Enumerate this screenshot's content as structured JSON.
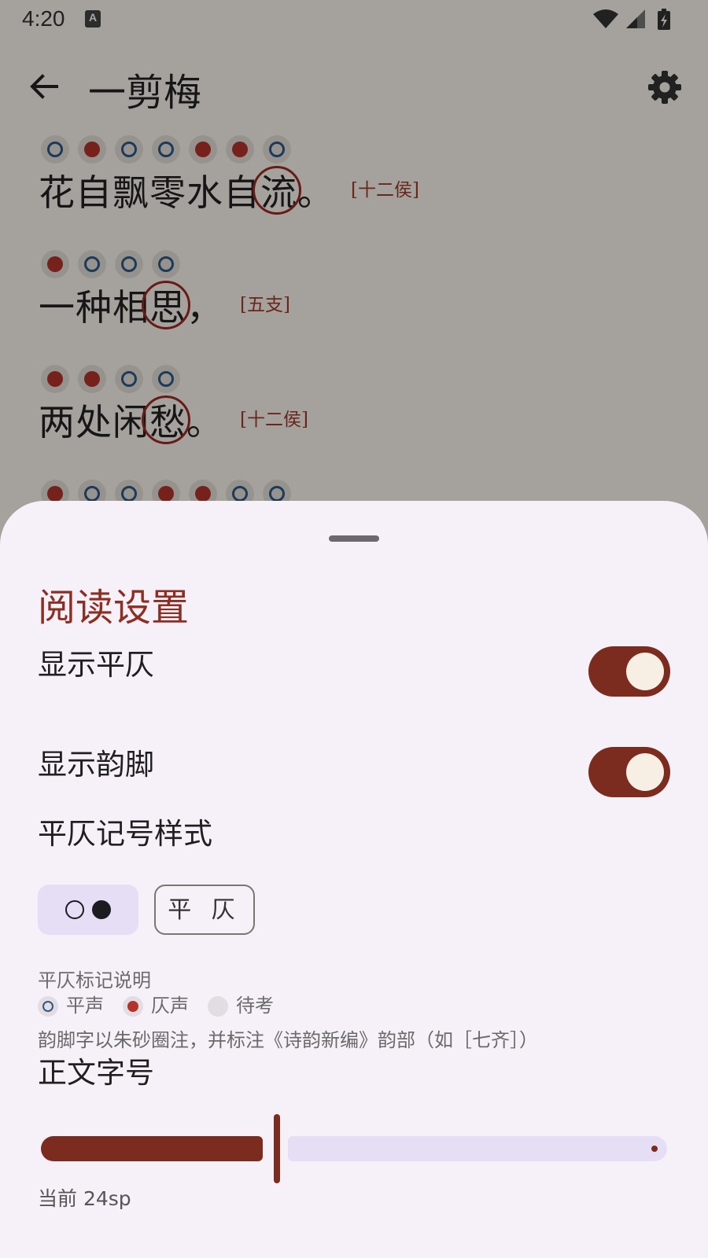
{
  "status_bar": {
    "time": "4:20",
    "notification_icon": "A"
  },
  "app_bar": {
    "title": "一剪梅"
  },
  "poem": {
    "lines": [
      {
        "chars": [
          "花",
          "自",
          "飘",
          "零",
          "水",
          "自",
          "流",
          "。"
        ],
        "marks": [
          "ping",
          "ze",
          "ping",
          "ping",
          "ze",
          "ze",
          "ping"
        ],
        "rhyme_index": 6,
        "rhyme_tag": "[十二侯]"
      },
      {
        "chars": [
          "一",
          "种",
          "相",
          "思",
          "，"
        ],
        "marks": [
          "ze",
          "ping",
          "ping",
          "ping"
        ],
        "rhyme_index": 3,
        "rhyme_tag": "[五支]"
      },
      {
        "chars": [
          "两",
          "处",
          "闲",
          "愁",
          "。"
        ],
        "marks": [
          "ze",
          "ze",
          "ping",
          "ping"
        ],
        "rhyme_index": 3,
        "rhyme_tag": "[十二侯]"
      },
      {
        "chars": [],
        "marks": [
          "ze",
          "ping",
          "ping",
          "ze",
          "ze",
          "ping",
          "ping"
        ],
        "rhyme_index": -1,
        "rhyme_tag": ""
      }
    ]
  },
  "sheet": {
    "title": "阅读设置",
    "show_tones": {
      "label": "显示平仄",
      "on": true
    },
    "show_rhyme": {
      "label": "显示韵脚",
      "on": true
    },
    "tone_style": {
      "label": "平仄记号样式",
      "option_text": "平 仄",
      "selected": "circles"
    },
    "legend": {
      "title": "平仄标记说明",
      "ping": "平声",
      "ze": "仄声",
      "unknown": "待考"
    },
    "note": "韵脚字以朱砂圈注，并标注《诗韵新编》韵部（如［七齐］）",
    "font_size": {
      "label": "正文字号",
      "current": "当前 24sp",
      "value_fraction": 0.38
    }
  },
  "colors": {
    "accent": "#7c2c1f",
    "ping": "#2c5a86",
    "ze": "#b3322a",
    "sheet_bg": "#f6f1f9",
    "chip_selected": "#e6def5"
  }
}
